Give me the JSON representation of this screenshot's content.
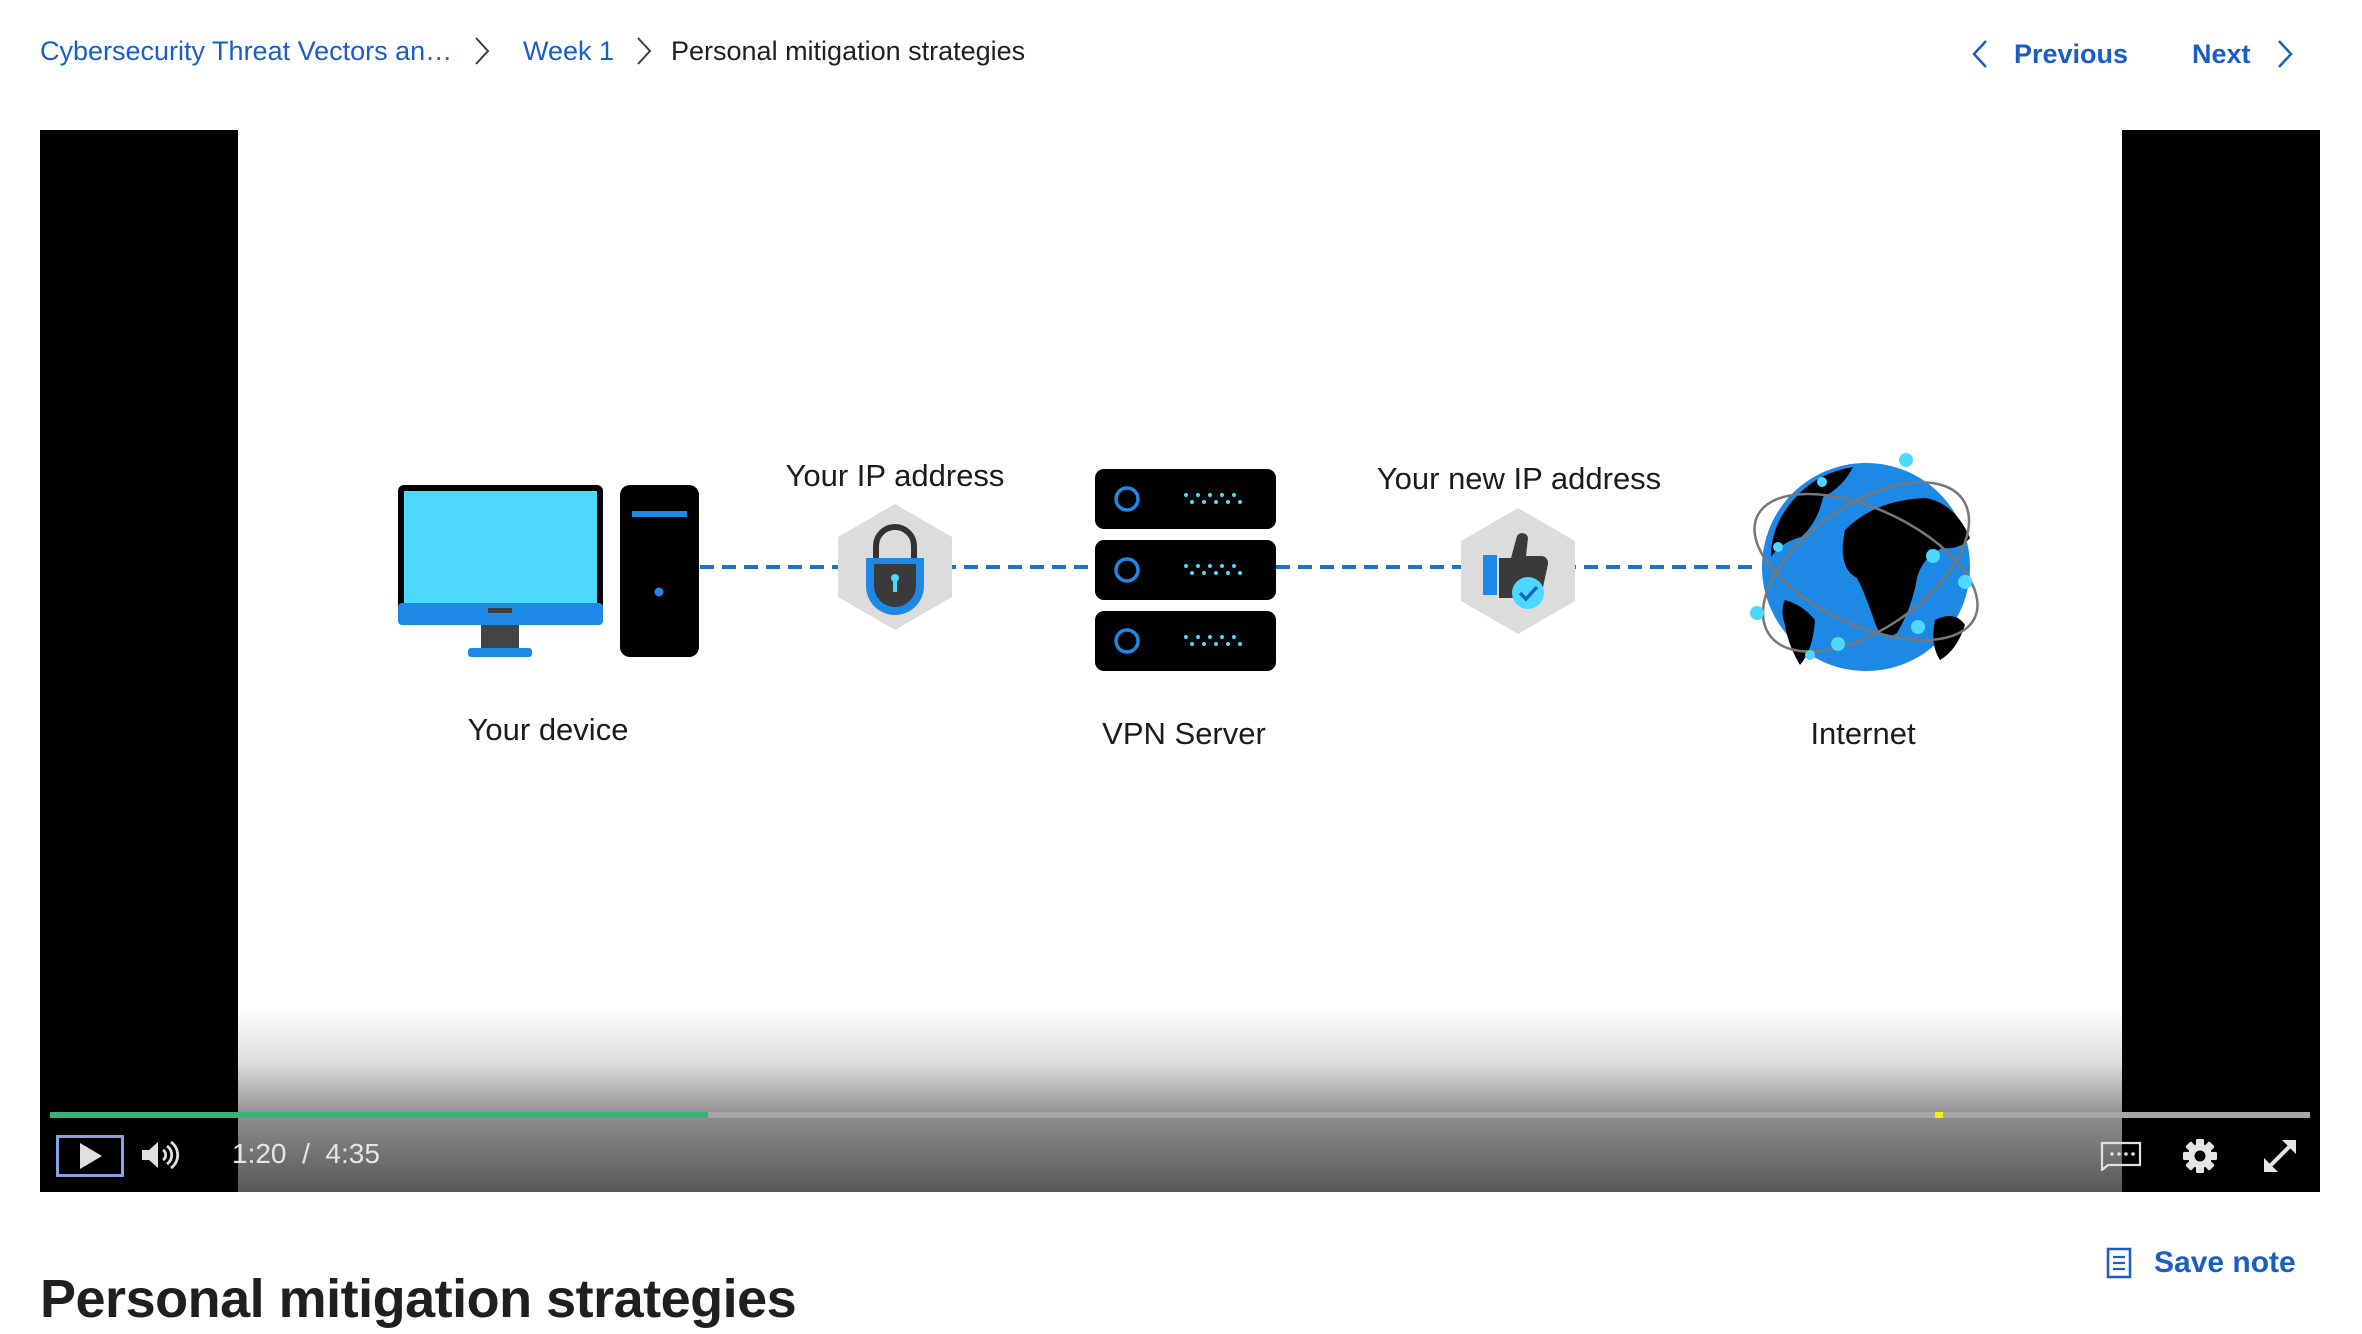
{
  "breadcrumb": {
    "items": [
      {
        "label": "Cybersecurity Threat Vectors an…",
        "link": true
      },
      {
        "label": "Week 1",
        "link": true
      },
      {
        "label": "Personal mitigation strategies",
        "link": false
      }
    ],
    "separator_icon": "chevron-right-icon"
  },
  "nav": {
    "previous_label": "Previous",
    "next_label": "Next",
    "previous_icon": "chevron-left-icon",
    "next_icon": "chevron-right-icon"
  },
  "video": {
    "diagram": {
      "labels": {
        "device": "Your device",
        "ip_address": "Your IP address",
        "vpn_server": "VPN Server",
        "new_ip_address": "Your new IP address",
        "internet": "Internet"
      },
      "icons": [
        "desktop-computer-icon",
        "padlock-icon",
        "server-rack-icon",
        "thumbs-up-check-icon",
        "globe-network-icon"
      ]
    },
    "player": {
      "current_time": "1:20",
      "separator": "/",
      "duration": "4:35",
      "progress_fraction": 0.291,
      "marker_fraction": 0.834,
      "colors": {
        "progress": "#3bb273",
        "track": "#a6a6a6",
        "marker": "#f2f200",
        "focus_ring": "#8aa0e0"
      },
      "buttons": {
        "play": "play-icon",
        "volume": "volume-icon",
        "captions": "captions-icon",
        "settings": "gear-icon",
        "fullscreen": "fullscreen-icon"
      }
    }
  },
  "page": {
    "title": "Personal mitigation strategies",
    "save_note_label": "Save note",
    "save_note_icon": "note-icon"
  },
  "colors": {
    "link": "#1a5cc8",
    "text": "#1f1f1f",
    "diagram_blue": "#1e88e5",
    "diagram_cyan": "#4dd8ff"
  }
}
